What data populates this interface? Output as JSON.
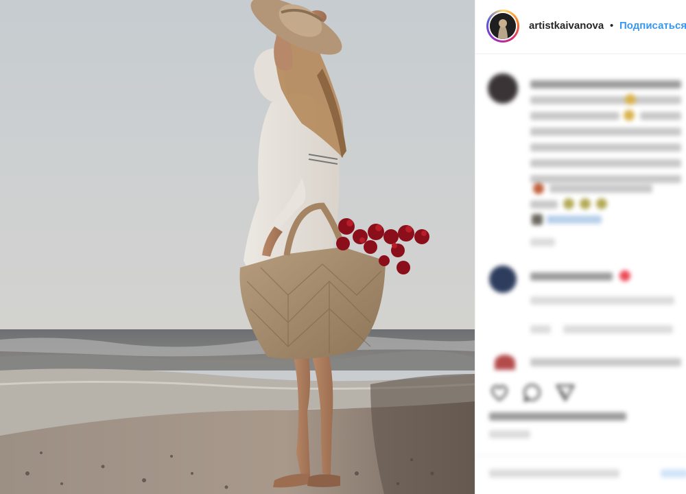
{
  "post": {
    "author": {
      "username": "artistkaivanova",
      "separator": "•",
      "follow_label": "Подписаться"
    }
  },
  "colors": {
    "follow_blue": "#3897f0",
    "text_dark": "#262626",
    "like_heart_red": "#ed4956"
  }
}
